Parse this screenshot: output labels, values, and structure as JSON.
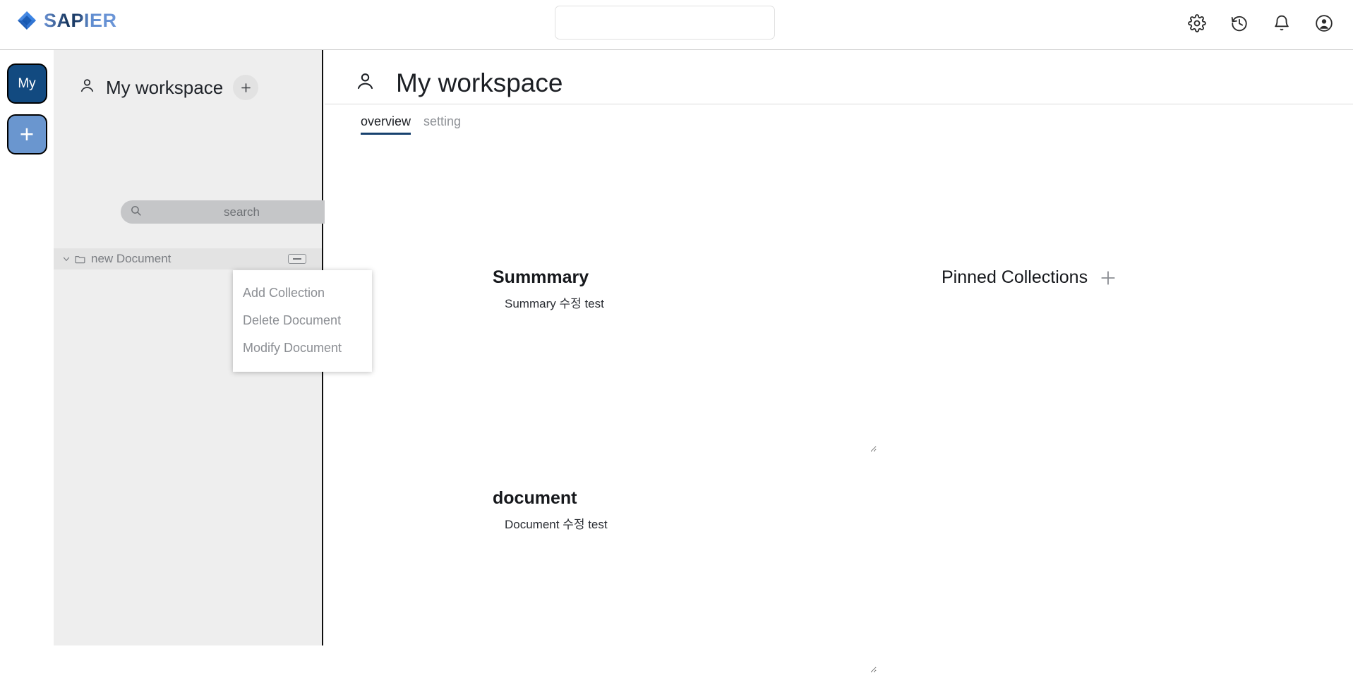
{
  "app": {
    "brand_name": "SAPIER",
    "brand_icon": "diamond-gem-icon"
  },
  "topbar": {
    "search_placeholder": "",
    "search_value": "",
    "icons": [
      {
        "name": "settings-gear-icon",
        "label": "Settings"
      },
      {
        "name": "history-clock-icon",
        "label": "History"
      },
      {
        "name": "notifications-bell-icon",
        "label": "Notifications"
      },
      {
        "name": "account-avatar-icon",
        "label": "Account"
      }
    ]
  },
  "rail": {
    "items": [
      {
        "name": "workspace-my-button",
        "label": "My",
        "color": "#124a80"
      },
      {
        "name": "workspace-add-button",
        "label": "+",
        "color": "#6a96cf"
      }
    ]
  },
  "sidebar": {
    "workspace_icon": "person-icon",
    "workspace_title": "My workspace",
    "add_button_label": "+",
    "search": {
      "placeholder": "search",
      "value": "",
      "icon": "search-magnifier-icon"
    },
    "tree": [
      {
        "label": "new Document",
        "chevron": "chevron-down-icon",
        "folder": "folder-icon",
        "collapse_icon": "minus-box-icon",
        "expanded": true
      }
    ]
  },
  "context_menu": {
    "items": [
      {
        "label": "Add Collection",
        "name": "ctx-add-collection"
      },
      {
        "label": "Delete Document",
        "name": "ctx-delete-document"
      },
      {
        "label": "Modify Document",
        "name": "ctx-modify-document"
      }
    ]
  },
  "main": {
    "page_icon": "person-icon",
    "page_title": "My workspace",
    "tabs": [
      {
        "label": "overview",
        "active": true
      },
      {
        "label": "setting",
        "active": false
      }
    ],
    "summary": {
      "heading": "Summmary",
      "value": "Summary 수정 test"
    },
    "document": {
      "heading": "document",
      "value": "Document 수정 test"
    },
    "pinned": {
      "heading": "Pinned Collections",
      "add_icon": "plus-icon"
    }
  },
  "colors": {
    "accent_navy": "#17416e",
    "rail_my": "#124a80",
    "rail_add": "#6a96cf",
    "sidebar_bg": "#eeeeee",
    "muted_text": "#8b8e93"
  }
}
